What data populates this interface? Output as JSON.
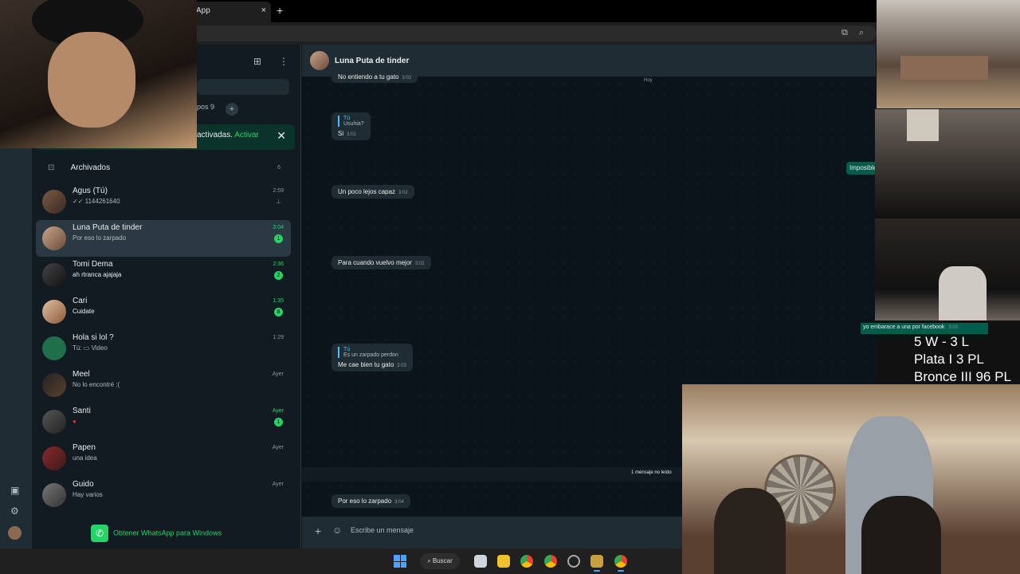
{
  "browser": {
    "tab_title": "App",
    "tab_close": "×",
    "new_tab": "+"
  },
  "sidebar": {
    "filter_chip": "pos 9",
    "notification": {
      "text": "activadas.",
      "action": "Activar"
    },
    "archived": {
      "label": "Archivados",
      "count": "6"
    },
    "chats": [
      {
        "name": "Agus (Tú)",
        "msg": "✓✓ 1144261640",
        "time": "2:59",
        "pinned": true
      },
      {
        "name": "Luna Puta de tinder",
        "msg": "Por eso lo zarpado",
        "time": "3:04",
        "unread": "1",
        "selected": true
      },
      {
        "name": "Tomi Dema",
        "msg": "ah rtranca ajajaja",
        "time": "2:36",
        "unread": "2"
      },
      {
        "name": "Cari",
        "msg": "Cuidate",
        "time": "1:35",
        "unread": "8"
      },
      {
        "name": "Hola si lol ?",
        "msg": "Tú: ▭ Video",
        "time": "1:29"
      },
      {
        "name": "Meel",
        "msg": "No lo encontré :(",
        "time": "Ayer"
      },
      {
        "name": "Santi",
        "msg": "●",
        "time": "Ayer",
        "unread": "1"
      },
      {
        "name": "Papen",
        "msg": "una idea",
        "time": "Ayer"
      },
      {
        "name": "Guido",
        "msg": "Hay varios",
        "time": "Ayer"
      }
    ],
    "get_app": "Obtener WhatsApp para Windows"
  },
  "chat": {
    "contact": "Luna Puta de tinder",
    "top_msg": {
      "text": "No entiendo a tu gato",
      "time": "3:02"
    },
    "day_label": "Hoy",
    "messages": [
      {
        "quote_who": "Tú",
        "quote": "Usuhia?",
        "text": "Si",
        "time": "3:02"
      },
      {
        "text": "Un poco lejos capaz",
        "time": "3:02"
      },
      {
        "text": "Para cuando vuelvo mejor",
        "time": "3:02"
      },
      {
        "quote_who": "Tú",
        "quote": "Es un zarpado perdon",
        "text": "Me cae bien tu gato",
        "time": "3:03"
      },
      {
        "text": "Por eso lo zarpado",
        "time": "3:04"
      }
    ],
    "unread_label": "1 mensaje no leído",
    "out_1": "Imposible",
    "out_2": {
      "text": "yo embarace a una por facebook",
      "time": "3:03"
    },
    "composer_placeholder": "Escribe un mensaje"
  },
  "overlay": {
    "stats": [
      "5 W - 3 L",
      "Plata I 3 PL",
      "Bronce III 96 PL"
    ]
  },
  "taskbar": {
    "search": "Buscar"
  }
}
